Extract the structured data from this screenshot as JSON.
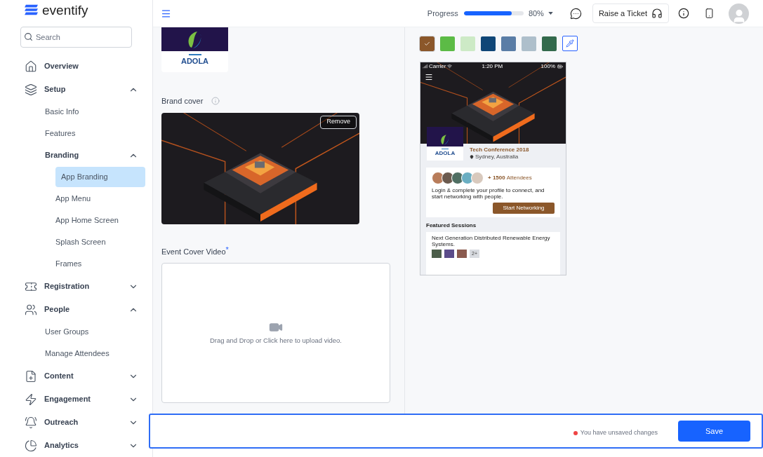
{
  "sidebar": {
    "logo": "eventify",
    "search_placeholder": "Search",
    "items": [
      {
        "label": "Overview",
        "selected": false
      },
      {
        "label": "Setup",
        "selected": false,
        "expanded": true,
        "children": [
          {
            "label": "Basic Info",
            "selected": false
          },
          {
            "label": "Features",
            "selected": false
          },
          {
            "label": "Branding",
            "selected": false,
            "expanded": true,
            "children": [
              {
                "label": "App Branding",
                "selected": true
              },
              {
                "label": "App Menu",
                "selected": false
              },
              {
                "label": "App Home Screen",
                "selected": false
              },
              {
                "label": "Splash Screen",
                "selected": false
              },
              {
                "label": "Frames",
                "selected": false
              }
            ]
          }
        ]
      },
      {
        "label": "Registration",
        "selected": false,
        "expanded": false
      },
      {
        "label": "People",
        "selected": false,
        "expanded": true,
        "children": [
          {
            "label": "User Groups",
            "selected": false
          },
          {
            "label": "Manage Attendees",
            "selected": false
          }
        ]
      },
      {
        "label": "Content",
        "selected": false,
        "expanded": false
      },
      {
        "label": "Engagement",
        "selected": false,
        "expanded": false
      },
      {
        "label": "Outreach",
        "selected": false,
        "expanded": false
      },
      {
        "label": "Analytics",
        "selected": false,
        "expanded": false
      }
    ]
  },
  "topbar": {
    "progress_label": "Progress",
    "level": 0.8,
    "reading": "80%",
    "ticket_button": "Raise a Ticket"
  },
  "branding": {
    "logo_text": "ADOLA",
    "brand_cover_label": "Brand cover",
    "remove_button": "Remove",
    "video_label": "Event Cover Video",
    "required_mark": "*",
    "upload_text": "Drag and Drop or Click here to upload video."
  },
  "swatches": [
    {
      "color": "#8b572a",
      "selected": true
    },
    {
      "color": "#5cbb46",
      "selected": false
    },
    {
      "color": "#cdeac6",
      "selected": false
    },
    {
      "color": "#0f4677",
      "selected": false
    },
    {
      "color": "#5a7da6",
      "selected": false
    },
    {
      "color": "#aebfcb",
      "selected": false
    },
    {
      "color": "#336a4c",
      "selected": false
    }
  ],
  "preview": {
    "carrier": "Carrier",
    "time": "1:20 PM",
    "battery": "100%",
    "logo_text": "ADOLA",
    "title": "Tech Conference 2018",
    "location": "Sydney, Australia",
    "attendee_count": "+ 1500",
    "attendee_label": "Attendees",
    "message": "Login & complete your profile to connect, and start networking with people.",
    "cta": "Start Networking",
    "sessions_heading": "Featured Sessions",
    "session_title": "Next Generation Distributed Renewable Energy Systems.",
    "more_speakers": "2+"
  },
  "footer": {
    "unsaved_text": "You have unsaved changes",
    "save_button": "Save"
  }
}
